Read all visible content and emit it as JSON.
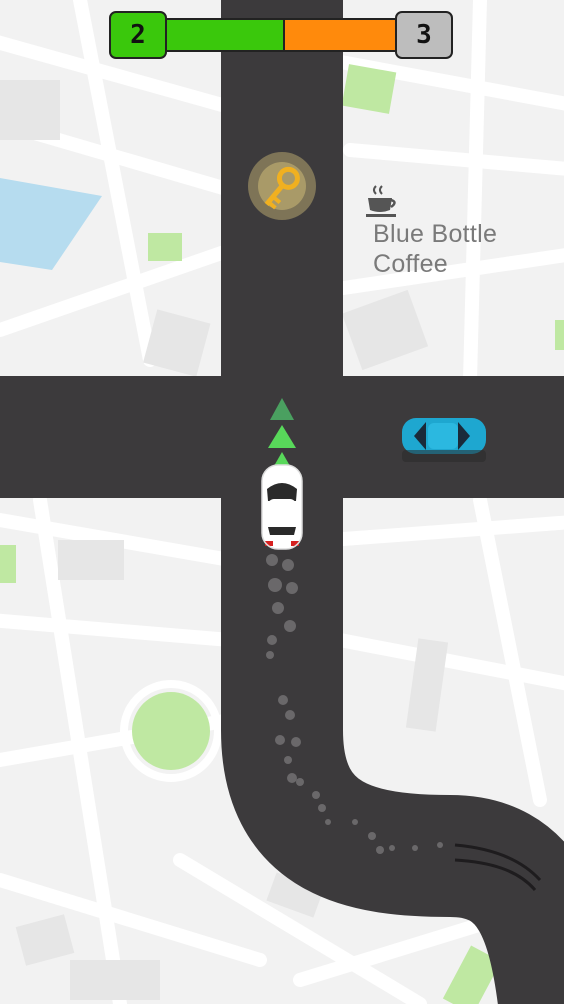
{
  "level": {
    "current": "2",
    "next": "3"
  },
  "progress": {
    "fraction": 0.5,
    "done_color": "#3ac80c",
    "remaining_color": "#ff8a0c"
  },
  "poi": {
    "name_line1": "Blue Bottle",
    "name_line2": "Coffee",
    "icon": "coffee-cup-icon"
  },
  "pickup": {
    "icon": "key-icon",
    "color": "#f0c030"
  },
  "player_car": {
    "color": "#ffffff",
    "accent": "#d62020"
  },
  "traffic_car": {
    "color": "#1ea7d0"
  },
  "direction_arrows": {
    "count": 3,
    "color": "#58d85a"
  },
  "colors": {
    "road": "#3c3a3c",
    "map_bg": "#f2f2f2",
    "park": "#bfe8a2",
    "water": "#b6dcef"
  }
}
